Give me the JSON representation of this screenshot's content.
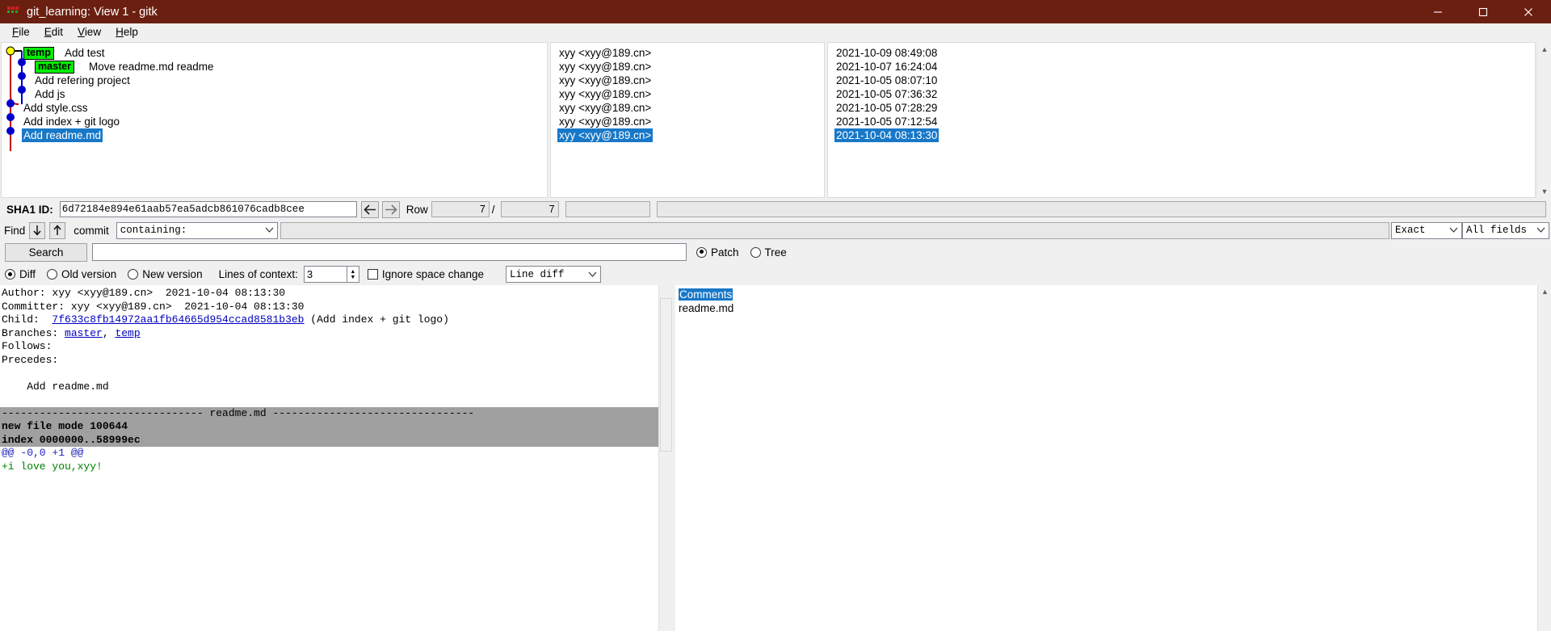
{
  "window": {
    "title": "git_learning: View 1 - gitk",
    "icon": "gitk-icon",
    "buttons": {
      "minimize": "minimize-icon",
      "maximize": "maximize-icon",
      "close": "close-icon"
    }
  },
  "menubar": {
    "items": [
      {
        "label": "File",
        "mnemonic": "F"
      },
      {
        "label": "Edit",
        "mnemonic": "E"
      },
      {
        "label": "View",
        "mnemonic": "V"
      },
      {
        "label": "Help",
        "mnemonic": "H"
      }
    ]
  },
  "commits": {
    "rows": [
      {
        "message": "Add test",
        "author": "xyy <xyy@189.cn>",
        "date": "2021-10-09 08:49:08",
        "ref": "temp",
        "selected": false
      },
      {
        "message": "Move readme.md readme",
        "author": "xyy <xyy@189.cn>",
        "date": "2021-10-07 16:24:04",
        "ref": "master",
        "selected": false
      },
      {
        "message": "Add refering project",
        "author": "xyy <xyy@189.cn>",
        "date": "2021-10-05 08:07:10",
        "ref": "",
        "selected": false
      },
      {
        "message": "Add js",
        "author": "xyy <xyy@189.cn>",
        "date": "2021-10-05 07:36:32",
        "ref": "",
        "selected": false
      },
      {
        "message": "Add style.css",
        "author": "xyy <xyy@189.cn>",
        "date": "2021-10-05 07:28:29",
        "ref": "",
        "selected": false
      },
      {
        "message": "Add index + git logo",
        "author": "xyy <xyy@189.cn>",
        "date": "2021-10-05 07:12:54",
        "ref": "",
        "selected": false
      },
      {
        "message": "Add readme.md",
        "author": "xyy <xyy@189.cn>",
        "date": "2021-10-04 08:13:30",
        "ref": "",
        "selected": true
      }
    ],
    "colors": {
      "selection": "#1878c8",
      "ref_tag": "#00ee00",
      "node_blue": "#0000cc",
      "node_head": "#ffff00",
      "line_red": "#cc0000",
      "line_blue": "#0000cc"
    }
  },
  "sha_row": {
    "label": "SHA1 ID:",
    "value": "6d72184e894e61aab57ea5adcb861076cadb8cee",
    "back_icon": "arrow-left-icon",
    "forward_icon": "arrow-right-icon",
    "row_label": "Row",
    "row_current": "7",
    "row_separator": "/",
    "row_total": "7"
  },
  "find_row": {
    "label": "Find",
    "down_icon": "arrow-down-icon",
    "up_icon": "arrow-up-icon",
    "commit_label": "commit",
    "containing": "containing:",
    "exact": "Exact",
    "all_fields": "All fields",
    "find_value": ""
  },
  "search_row": {
    "button": "Search",
    "input_value": "",
    "patch_label": "Patch",
    "tree_label": "Tree",
    "patch_selected": true,
    "tree_selected": false
  },
  "diff_options": {
    "diff_label": "Diff",
    "old_version_label": "Old version",
    "new_version_label": "New version",
    "diff_selected": true,
    "old_selected": false,
    "new_selected": false,
    "context_label": "Lines of context:",
    "context_value": "3",
    "ignore_space_label": "Ignore space change",
    "ignore_space_checked": false,
    "line_diff": "Line diff"
  },
  "diff": {
    "lines": [
      {
        "text": "Author: xyy <xyy@189.cn>  2021-10-04 08:13:30",
        "style": "plain"
      },
      {
        "text": "Committer: xyy <xyy@189.cn>  2021-10-04 08:13:30",
        "style": "plain"
      },
      {
        "text": "Child:  ",
        "style": "plain",
        "link": "7f633c8fb14972aa1fb64665d954ccad8581b3eb",
        "suffix": " (Add index + git logo)"
      },
      {
        "text": "Branches: ",
        "style": "plain",
        "links": [
          "master",
          "temp"
        ],
        "separator": ", "
      },
      {
        "text": "Follows: ",
        "style": "plain"
      },
      {
        "text": "Precedes: ",
        "style": "plain"
      },
      {
        "text": "",
        "style": "plain"
      },
      {
        "text": "    Add readme.md",
        "style": "plain"
      },
      {
        "text": "",
        "style": "plain"
      },
      {
        "text": "-------------------------------- readme.md --------------------------------",
        "style": "filehdr"
      },
      {
        "text": "new file mode 100644",
        "style": "fileinfo"
      },
      {
        "text": "index 0000000..58999ec",
        "style": "fileinfo"
      },
      {
        "text": "@@ -0,0 +1 @@",
        "style": "hunk"
      },
      {
        "text": "+i love you,xyy!",
        "style": "add"
      }
    ]
  },
  "tree": {
    "items": [
      {
        "label": "Comments",
        "highlighted": true
      },
      {
        "label": "readme.md",
        "highlighted": false
      }
    ]
  }
}
